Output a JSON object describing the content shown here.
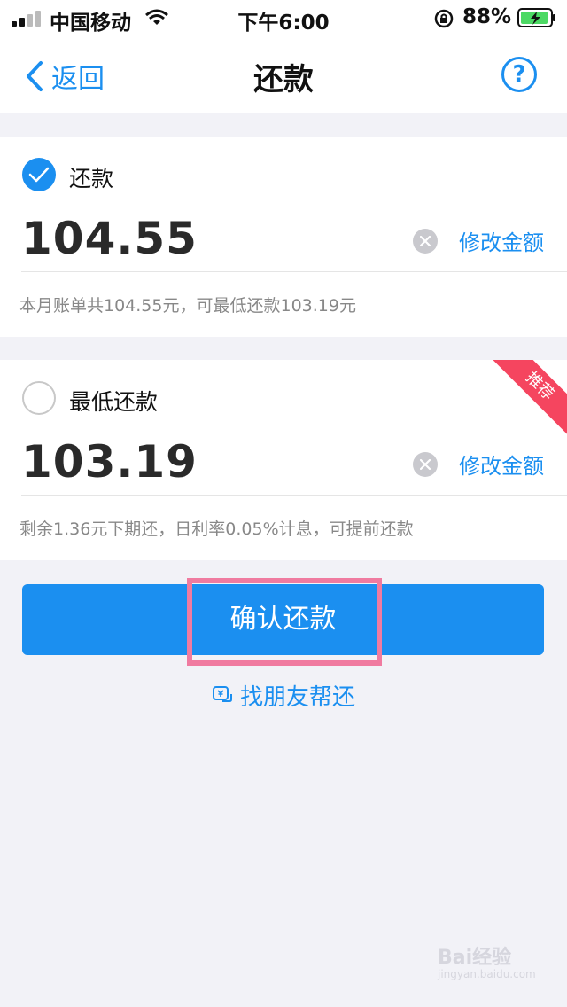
{
  "status_bar": {
    "carrier": "中国移动",
    "time": "下午6:00",
    "battery": "88%"
  },
  "nav": {
    "back_label": "返回",
    "title": "还款",
    "help_label": "?"
  },
  "option_full": {
    "label": "还款",
    "checked": true,
    "amount": "104.55",
    "modify_label": "修改金额",
    "hint": "本月账单共104.55元，可最低还款103.19元"
  },
  "option_min": {
    "label": "最低还款",
    "checked": false,
    "amount": "103.19",
    "modify_label": "修改金额",
    "hint": "剩余1.36元下期还，日利率0.05%计息，可提前还款",
    "badge": "推荐"
  },
  "confirm_label": "确认还款",
  "friend_label": "找朋友帮还",
  "watermark": {
    "text": "Bai经验",
    "sub": "jingyan.baidu.com"
  },
  "colors": {
    "accent": "#1b8ff0",
    "badge": "#f5455f",
    "highlight": "#f07ba0"
  }
}
